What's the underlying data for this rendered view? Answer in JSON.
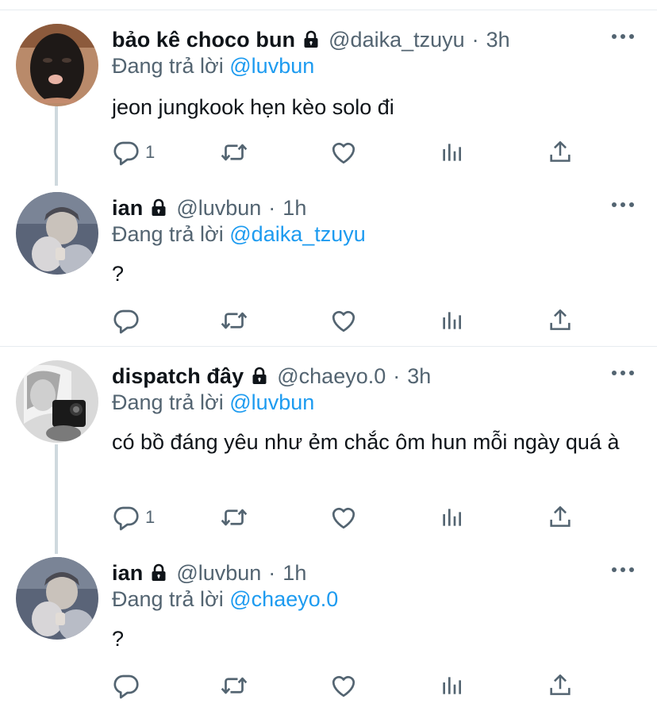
{
  "reply_prefix": "Đang trả lời ",
  "tweets": [
    {
      "name": "bảo kê choco bun",
      "handle": "@daika_tzuyu",
      "separator": "·",
      "time": "3h",
      "reply_to": "@luvbun",
      "text": "jeon jungkook hẹn kèo solo đi",
      "reply_count": "1",
      "avatar": "dark-mask-avatar"
    },
    {
      "name": "ian",
      "handle": "@luvbun",
      "separator": "·",
      "time": "1h",
      "reply_to": "@daika_tzuyu",
      "text": "?",
      "reply_count": "",
      "avatar": "grey-selfie-avatar"
    },
    {
      "name": "dispatch đây",
      "handle": "@chaeyo.0",
      "separator": "·",
      "time": "3h",
      "reply_to": "@luvbun",
      "text": "có bồ đáng yêu như ẻm chắc ôm hun mỗi ngày quá à",
      "reply_count": "1",
      "avatar": "bw-phone-selfie-avatar"
    },
    {
      "name": "ian",
      "handle": "@luvbun",
      "separator": "·",
      "time": "1h",
      "reply_to": "@chaeyo.0",
      "text": "?",
      "reply_count": "",
      "avatar": "grey-selfie-avatar"
    }
  ],
  "icons": {
    "reply": "reply-icon",
    "retweet": "retweet-icon",
    "like": "heart-icon",
    "views": "analytics-icon",
    "share": "share-icon",
    "more": "more-icon",
    "protected": "lock-icon"
  },
  "colors": {
    "text": "#0f1419",
    "secondary": "#536471",
    "mention": "#1d9bf0",
    "divider": "#e6ecf0",
    "thread_line": "#cfd9de"
  }
}
